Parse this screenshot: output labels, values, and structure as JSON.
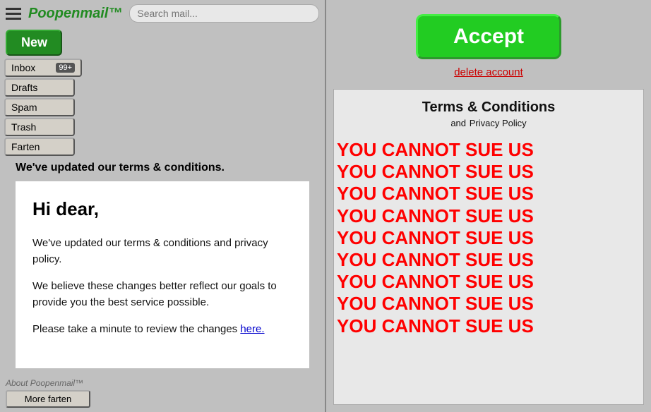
{
  "app": {
    "title": "Poopenmail™",
    "trademark": "™"
  },
  "header": {
    "search_placeholder": "Search mail..."
  },
  "new_button": "New",
  "nav": {
    "items": [
      {
        "label": "Inbox",
        "badge": "99+"
      },
      {
        "label": "Drafts",
        "badge": null
      },
      {
        "label": "Spam",
        "badge": null
      },
      {
        "label": "Trash",
        "badge": null
      },
      {
        "label": "Farten",
        "badge": null
      }
    ]
  },
  "update_notice": "We've updated our terms & conditions.",
  "email": {
    "greeting": "Hi dear,",
    "body_1": "We've updated our terms & conditions and privacy policy.",
    "body_2": "We believe these changes better reflect our goals to provide you the best service possible.",
    "body_3_before": "Please take a minute to review the changes ",
    "body_3_link": "here.",
    "body_3_after": ""
  },
  "footer": {
    "about": "About Poopenmail™",
    "more": "More farten"
  },
  "right": {
    "accept_label": "Accept",
    "delete_label": "delete account",
    "terms_title": "Terms & Conditions",
    "terms_subtitle_prefix": "and",
    "terms_subtitle": "Privacy Policy",
    "repeated_text": "YOU CANNOT SUE US"
  }
}
